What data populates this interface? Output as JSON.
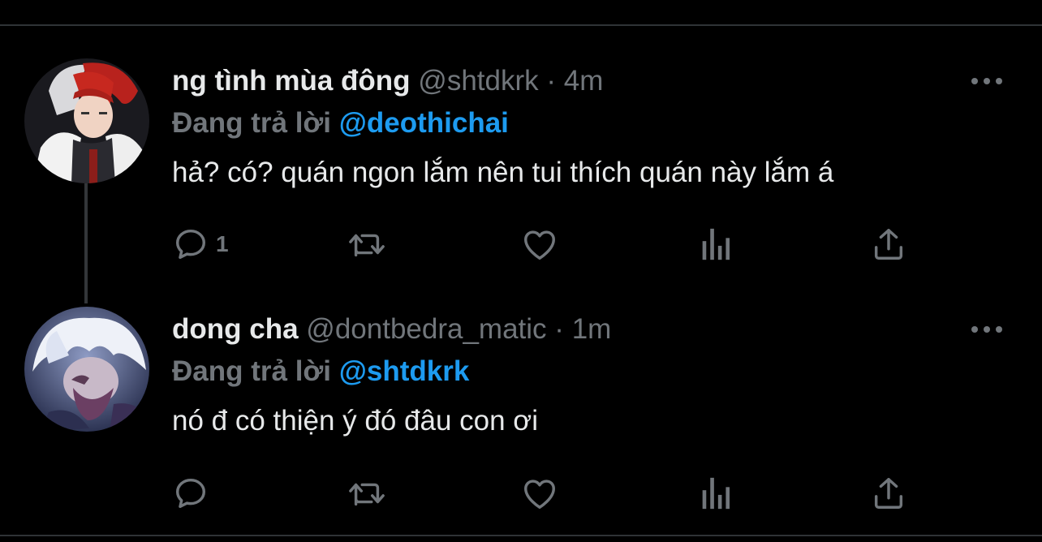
{
  "tweets": [
    {
      "name": "ng tình mùa đông",
      "handle": "@shtdkrk",
      "separator": "·",
      "time": "4m",
      "reply_prefix": "Đang trả lời",
      "reply_to": "@deothichai",
      "text": "hả? có? quán ngon lắm nên tui thích quán này lắm á",
      "reply_count": "1",
      "avatar_icon": "avatar-red-white-hair"
    },
    {
      "name": "dong cha",
      "handle": "@dontbedra_matic",
      "separator": "·",
      "time": "1m",
      "reply_prefix": "Đang trả lời",
      "reply_to": "@shtdkrk",
      "text": "nó đ có thiện ý đó đâu con ơi",
      "reply_count": "",
      "avatar_icon": "avatar-white-hair"
    }
  ],
  "colors": {
    "background": "#000000",
    "text": "#e7e9ea",
    "muted": "#71767b",
    "accent": "#1d9bf0",
    "border": "#2f3336"
  }
}
